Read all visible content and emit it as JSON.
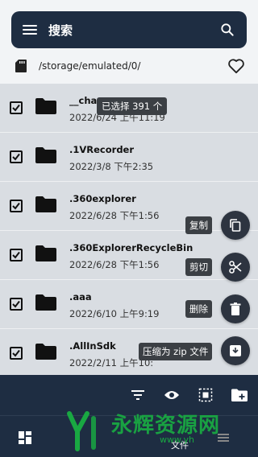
{
  "header": {
    "title": "搜索"
  },
  "path": {
    "current": "/storage/emulated/0/"
  },
  "selection_badge": "已选择 391 个",
  "rows": [
    {
      "name": "__cha",
      "date": "2022/6/24 上午11:19",
      "checked": true
    },
    {
      "name": ".1VRecorder",
      "date": "2022/3/8 下午2:35",
      "checked": true
    },
    {
      "name": ".360explorer",
      "date": "2022/6/28 下午1:56",
      "checked": true
    },
    {
      "name": ".360ExplorerRecycleBin",
      "date": "2022/6/28 下午1:56",
      "checked": true
    },
    {
      "name": ".aaa",
      "date": "2022/6/10 上午9:19",
      "checked": true
    },
    {
      "name": ".AllInSdk",
      "date": "2022/2/11 上午10:",
      "checked": true
    }
  ],
  "fab_actions": {
    "copy": "复制",
    "cut": "剪切",
    "delete": "删除",
    "zip": "压缩为 zip 文件"
  },
  "bottom_nav": {
    "files_label": "文件"
  },
  "watermark": {
    "text": "永辉资源网",
    "url": "www.yh"
  },
  "colors": {
    "bar": "#1e2d42",
    "row_selected": "#d9dde2",
    "watermark": "#19a842"
  }
}
